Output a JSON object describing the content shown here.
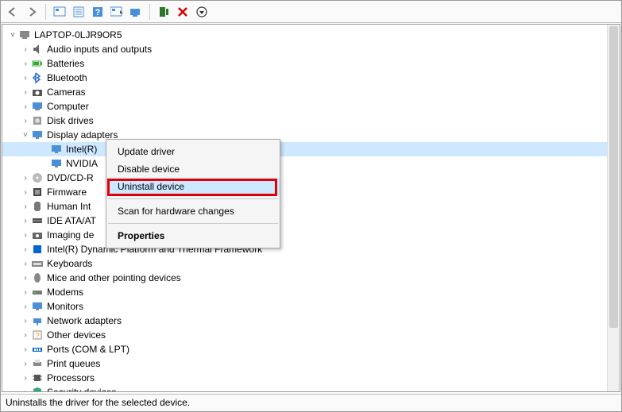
{
  "root_node": "LAPTOP-0LJR9OR5",
  "categories": [
    {
      "label": "Audio inputs and outputs",
      "icon": "audio"
    },
    {
      "label": "Batteries",
      "icon": "battery"
    },
    {
      "label": "Bluetooth",
      "icon": "bt"
    },
    {
      "label": "Cameras",
      "icon": "camera"
    },
    {
      "label": "Computer",
      "icon": "computer"
    },
    {
      "label": "Disk drives",
      "icon": "disk"
    },
    {
      "label": "Display adapters",
      "icon": "display",
      "expanded": true,
      "children": [
        {
          "label": "Intel(R)",
          "icon": "display",
          "selected": true
        },
        {
          "label": "NVIDIA",
          "icon": "display"
        }
      ]
    },
    {
      "label": "DVD/CD-R",
      "icon": "dvd"
    },
    {
      "label": "Firmware",
      "icon": "firmware"
    },
    {
      "label": "Human Int",
      "icon": "hid"
    },
    {
      "label": "IDE ATA/AT",
      "icon": "ide"
    },
    {
      "label": "Imaging de",
      "icon": "imaging"
    },
    {
      "label": "Intel(R) Dynamic Platform and Thermal Framework",
      "icon": "intel"
    },
    {
      "label": "Keyboards",
      "icon": "keyboard"
    },
    {
      "label": "Mice and other pointing devices",
      "icon": "mouse"
    },
    {
      "label": "Modems",
      "icon": "modem"
    },
    {
      "label": "Monitors",
      "icon": "monitor"
    },
    {
      "label": "Network adapters",
      "icon": "net"
    },
    {
      "label": "Other devices",
      "icon": "other"
    },
    {
      "label": "Ports (COM & LPT)",
      "icon": "port"
    },
    {
      "label": "Print queues",
      "icon": "print"
    },
    {
      "label": "Processors",
      "icon": "cpu"
    },
    {
      "label": "Security devices",
      "icon": "security"
    }
  ],
  "context_menu": {
    "items": [
      {
        "label": "Update driver"
      },
      {
        "label": "Disable device"
      },
      {
        "label": "Uninstall device",
        "hover": true,
        "highlighted": true
      },
      {
        "sep": true
      },
      {
        "label": "Scan for hardware changes"
      },
      {
        "sep": true
      },
      {
        "label": "Properties",
        "bold": true
      }
    ]
  },
  "statusbar": "Uninstalls the driver for the selected device.",
  "toolbar_icons": [
    "back",
    "forward",
    "show",
    "details",
    "help",
    "view",
    "monitor",
    "scan",
    "delete",
    "more"
  ]
}
